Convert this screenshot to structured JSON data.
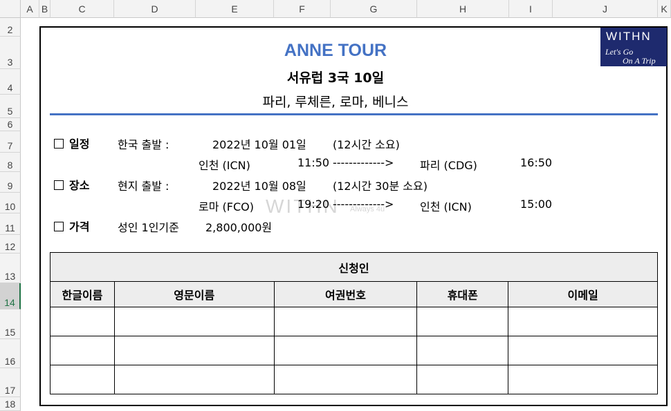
{
  "columns": [
    "A",
    "B",
    "C",
    "D",
    "E",
    "F",
    "G",
    "H",
    "I",
    "J",
    "K"
  ],
  "rows": [
    "2",
    "3",
    "4",
    "5",
    "6",
    "7",
    "8",
    "9",
    "10",
    "11",
    "12",
    "13",
    "14",
    "15",
    "16",
    "17",
    "18"
  ],
  "selected_row": "14",
  "logo": {
    "brand": "WITHN",
    "line1": "Let's Go",
    "line2": "On A Trip"
  },
  "watermark": {
    "brand": "WITHN",
    "tag": "Always 4u"
  },
  "header": {
    "title": "ANNE TOUR",
    "subtitle": "서유럽 3국 10일",
    "cities": "파리, 루체른, 로마, 베니스"
  },
  "itinerary": {
    "schedule_label": "일정",
    "korea_depart_label": "한국 출발 :",
    "korea_depart_date": "2022년 10월 01일",
    "korea_depart_duration": "(12시간 소요)",
    "out_from": "인천 (ICN)",
    "out_time": "11:50",
    "arrow": "------------->",
    "out_to": "파리 (CDG)",
    "out_arrive": "16:50",
    "place_label": "장소",
    "local_depart_label": "현지 출발 :",
    "local_depart_date": "2022년 10월 08일",
    "local_depart_duration": "(12시간 30분 소요)",
    "ret_from": "로마 (FCO)",
    "ret_time": "19:20",
    "ret_arrow": "------------->",
    "ret_to": "인천 (ICN)",
    "ret_arrive": "15:00",
    "price_label": "가격",
    "price_basis": "성인 1인기준",
    "price_value": "2,800,000원"
  },
  "applicants": {
    "title": "신청인",
    "columns": [
      "한글이름",
      "영문이름",
      "여권번호",
      "휴대폰",
      "이메일"
    ]
  }
}
